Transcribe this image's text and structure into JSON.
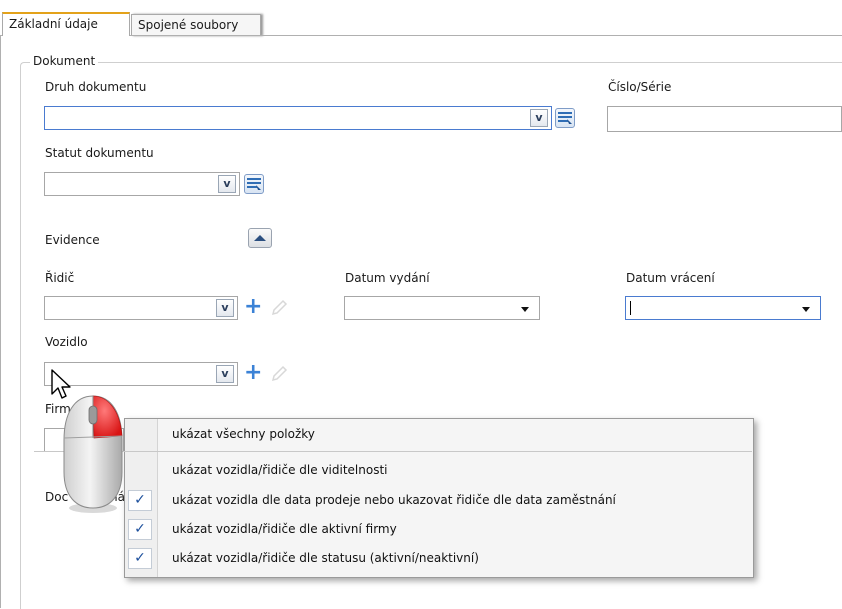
{
  "tabs": [
    {
      "label": "Základní údaje",
      "active": true
    },
    {
      "label": "Spojené soubory",
      "active": false
    }
  ],
  "group": {
    "title": "Dokument",
    "druh_label": "Druh dokumentu",
    "druh_value": "",
    "cislo_label": "Číslo/Série",
    "cislo_value": "",
    "statut_label": "Statut dokumentu",
    "statut_value": "",
    "evidence_label": "Evidence",
    "ridic_label": "Řidič",
    "ridic_value": "",
    "datum_vydani_label": "Datum vydání",
    "datum_vydani_value": "",
    "datum_vraceni_label": "Datum vrácení",
    "datum_vraceni_value": "",
    "vozidlo_label": "Vozidlo",
    "vozidlo_value": "",
    "firma_label": "Firm",
    "doc_label": "Doc",
    "doc_label_end": "ná"
  },
  "icons": {
    "chevron": "v",
    "plus": "+",
    "check": "✓"
  },
  "context_menu": {
    "items": [
      {
        "label": "ukázat všechny položky",
        "checked": false
      },
      {
        "label": "ukázat vozidla/řidiče dle viditelnosti",
        "checked": false
      },
      {
        "label": "ukázat vozidla dle data prodeje nebo ukazovat řidiče dle data zaměstnání",
        "checked": true
      },
      {
        "label": "ukázat vozidla/řidiče dle aktivní firmy",
        "checked": true
      },
      {
        "label": "ukázat vozidla/řidiče dle statusu (aktivní/neaktivní)",
        "checked": true
      }
    ]
  },
  "colors": {
    "tab_accent": "#e3a21a",
    "focus_border": "#4a7bd0",
    "plus_blue": "#3b82d6",
    "check_blue": "#1c4f9c"
  }
}
